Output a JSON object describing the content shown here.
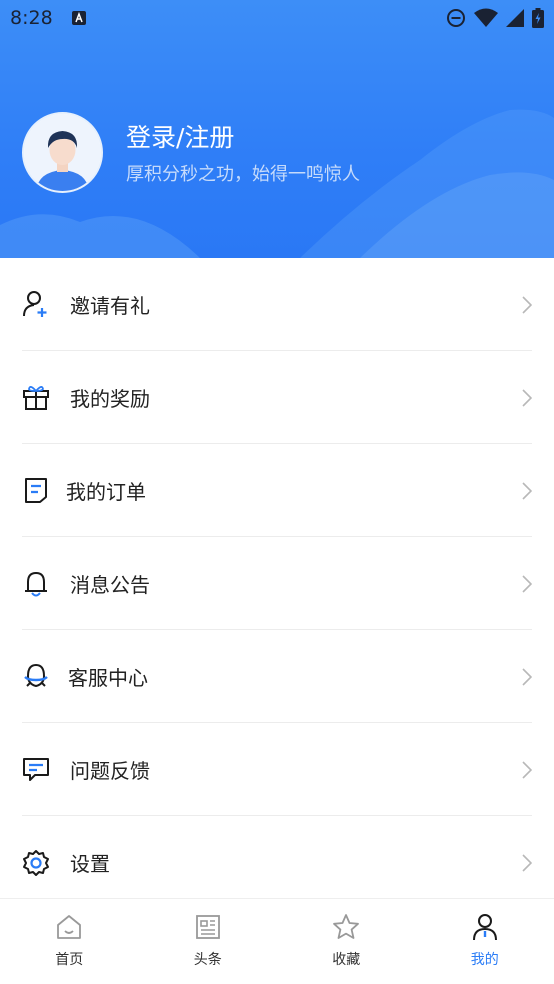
{
  "status_bar": {
    "time": "8:28",
    "notification_icon": "a-app-icon"
  },
  "profile": {
    "title": "登录/注册",
    "subtitle": "厚积分秒之功，始得一鸣惊人"
  },
  "menu": [
    {
      "label": "邀请有礼",
      "icon": "add-user-icon"
    },
    {
      "label": "我的奖励",
      "icon": "gift-icon"
    },
    {
      "label": "我的订单",
      "icon": "order-icon"
    },
    {
      "label": "消息公告",
      "icon": "bell-icon"
    },
    {
      "label": "客服中心",
      "icon": "customer-service-icon"
    },
    {
      "label": "问题反馈",
      "icon": "feedback-icon"
    },
    {
      "label": "设置",
      "icon": "gear-icon"
    }
  ],
  "tabs": [
    {
      "label": "首页",
      "icon": "home-icon",
      "active": false
    },
    {
      "label": "头条",
      "icon": "news-icon",
      "active": false
    },
    {
      "label": "收藏",
      "icon": "star-icon",
      "active": false
    },
    {
      "label": "我的",
      "icon": "person-icon",
      "active": true
    }
  ],
  "colors": {
    "accent": "#2a7cf6",
    "header": "#2f7ef7",
    "text": "#222222",
    "divider": "#ececec"
  }
}
